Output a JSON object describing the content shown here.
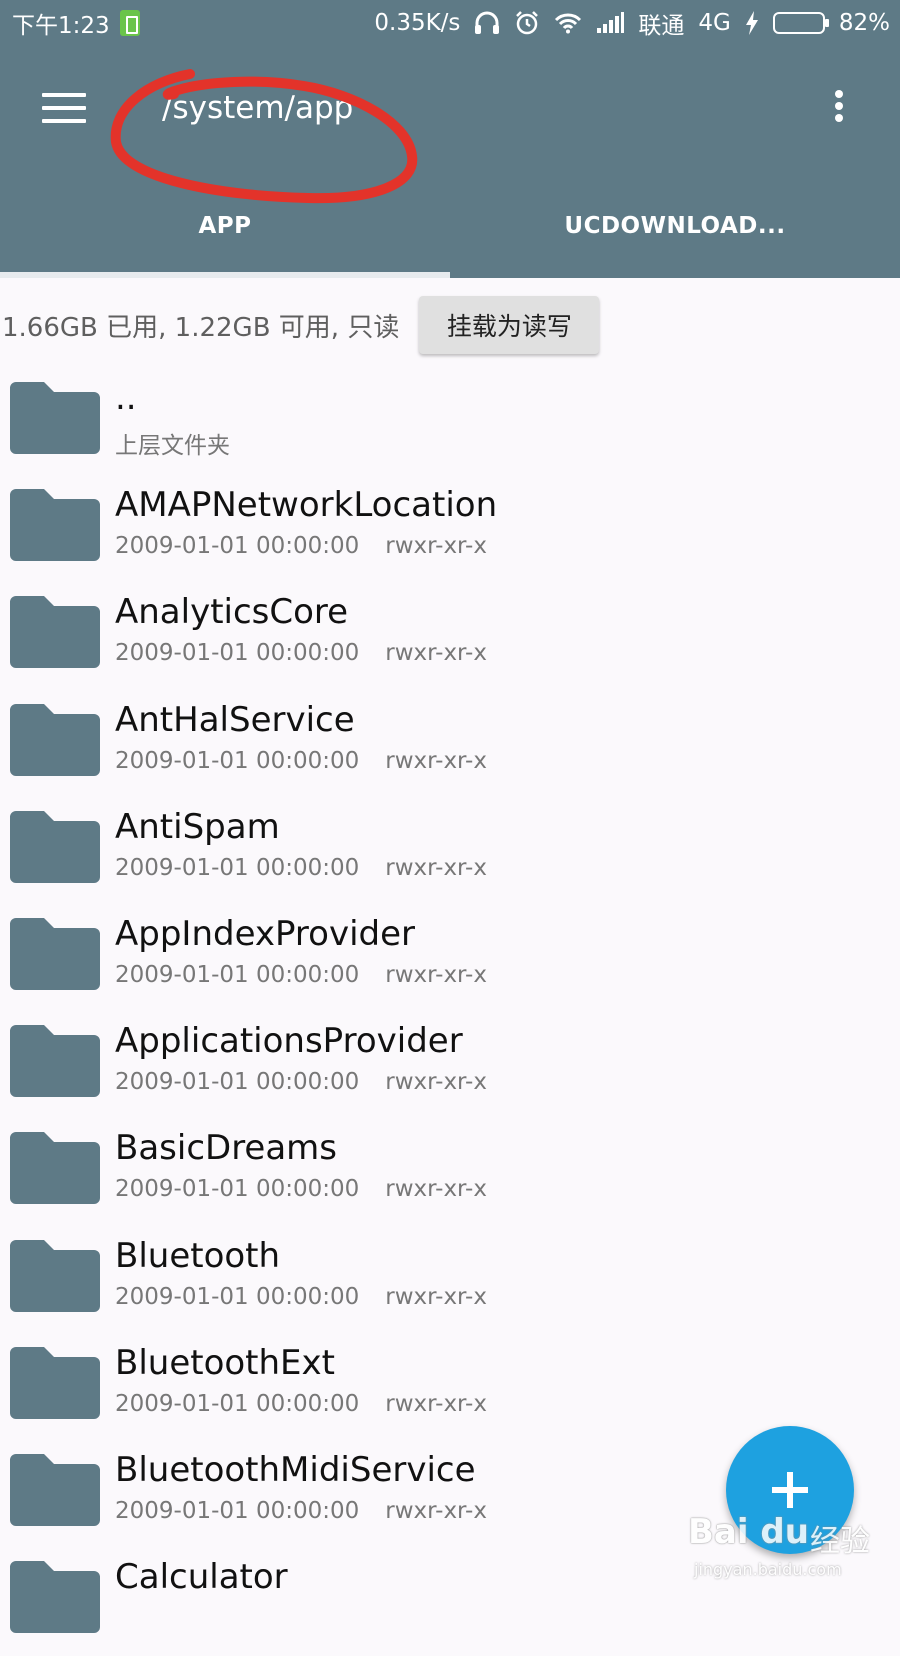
{
  "status_bar": {
    "time": "下午1:23",
    "speed": "0.35K/s",
    "carrier": "联通",
    "network": "4G",
    "battery": "82%",
    "battery_level": 0.82
  },
  "app_bar": {
    "path": "/system/app",
    "annotation_color": "#e3332a"
  },
  "tabs": [
    {
      "label": "APP",
      "active": true
    },
    {
      "label": "UCDOWNLOAD...",
      "active": false
    }
  ],
  "storage": {
    "info": "1.66GB 已用, 1.22GB 可用, 只读",
    "mount_button": "挂载为读写"
  },
  "files": [
    {
      "name": "..",
      "date": "上层文件夹",
      "perm": ""
    },
    {
      "name": "AMAPNetworkLocation",
      "date": "2009-01-01 00:00:00",
      "perm": "rwxr-xr-x"
    },
    {
      "name": "AnalyticsCore",
      "date": "2009-01-01 00:00:00",
      "perm": "rwxr-xr-x"
    },
    {
      "name": "AntHalService",
      "date": "2009-01-01 00:00:00",
      "perm": "rwxr-xr-x"
    },
    {
      "name": "AntiSpam",
      "date": "2009-01-01 00:00:00",
      "perm": "rwxr-xr-x"
    },
    {
      "name": "AppIndexProvider",
      "date": "2009-01-01 00:00:00",
      "perm": "rwxr-xr-x"
    },
    {
      "name": "ApplicationsProvider",
      "date": "2009-01-01 00:00:00",
      "perm": "rwxr-xr-x"
    },
    {
      "name": "BasicDreams",
      "date": "2009-01-01 00:00:00",
      "perm": "rwxr-xr-x"
    },
    {
      "name": "Bluetooth",
      "date": "2009-01-01 00:00:00",
      "perm": "rwxr-xr-x"
    },
    {
      "name": "BluetoothExt",
      "date": "2009-01-01 00:00:00",
      "perm": "rwxr-xr-x"
    },
    {
      "name": "BluetoothMidiService",
      "date": "2009-01-01 00:00:00",
      "perm": "rwxr-xr-x"
    },
    {
      "name": "Calculator",
      "date": "",
      "perm": ""
    }
  ],
  "fab": {
    "icon": "plus-icon"
  },
  "watermark": {
    "logo": "Bai du",
    "text": "经验",
    "url": "jingyan.baidu.com"
  },
  "colors": {
    "toolbar": "#5e7a86",
    "folder": "#5e7a86",
    "fab": "#1ea1e0",
    "background": "#fbf9fc"
  }
}
